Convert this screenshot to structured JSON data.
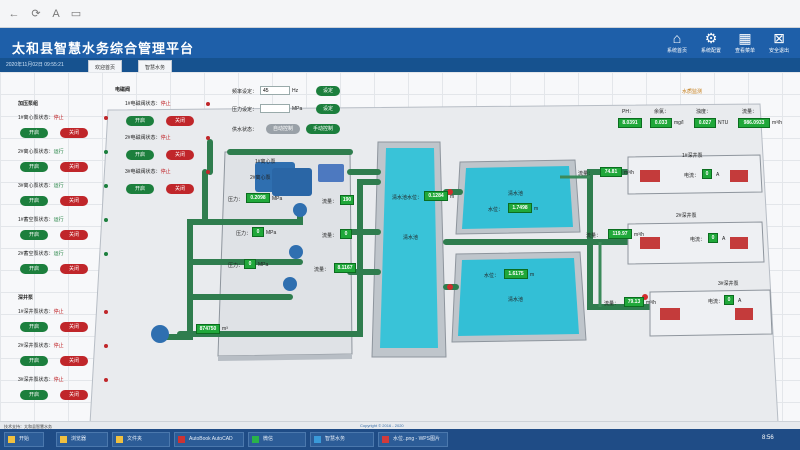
{
  "browser": {
    "back_icon": "←",
    "refresh_icon": "⟳",
    "font_icon": "A",
    "window_icon": "▭"
  },
  "header": {
    "title": "太和县智慧水务综合管理平台",
    "date": "2020年11月02日 09:55:21"
  },
  "topnav": [
    {
      "icon": "home-icon",
      "glyph": "⌂",
      "label": "系统首页"
    },
    {
      "icon": "gear-icon",
      "glyph": "⚙",
      "label": "系统配置"
    },
    {
      "icon": "grid-icon",
      "glyph": "▦",
      "label": "查看菜单"
    },
    {
      "icon": "logout-icon",
      "glyph": "⊠",
      "label": "安全退出"
    }
  ],
  "tabs": [
    {
      "label": "欢迎首页"
    },
    {
      "label": "智慧水务"
    }
  ],
  "left_panel": {
    "pressure_section_title": "加压泵组",
    "pressure_pumps": [
      {
        "label": "1#离心泵状态：",
        "status": "停止",
        "status_class": "stop",
        "start": "开启",
        "stop": "关闭"
      },
      {
        "label": "2#离心泵状态：",
        "status": "运行",
        "status_class": "run",
        "start": "开启",
        "stop": "关闭"
      },
      {
        "label": "3#离心泵状态：",
        "status": "运行",
        "status_class": "run",
        "start": "开启",
        "stop": "关闭"
      },
      {
        "label": "1#蓄空泵状态：",
        "status": "运行",
        "status_class": "run",
        "start": "开启",
        "stop": "关闭"
      },
      {
        "label": "2#蓄空泵状态：",
        "status": "运行",
        "status_class": "run",
        "start": "开启",
        "stop": "关闭"
      }
    ],
    "deep_section_title": "深井泵",
    "deep_pumps": [
      {
        "label": "1#深井泵状态：",
        "status": "停止",
        "status_class": "stop",
        "start": "开启",
        "stop": "关闭"
      },
      {
        "label": "2#深井泵状态：",
        "status": "停止",
        "status_class": "stop",
        "start": "开启",
        "stop": "关闭"
      },
      {
        "label": "3#深井泵状态：",
        "status": "停止",
        "status_class": "stop",
        "start": "开启",
        "stop": "关闭"
      }
    ],
    "valve_section_title": "电磁阀",
    "valves": [
      {
        "label": "1#电磁阀状态：",
        "status": "停止",
        "status_class": "stop",
        "start": "开启",
        "stop": "关闭"
      },
      {
        "label": "2#电磁阀状态：",
        "status": "停止",
        "status_class": "stop",
        "start": "开启",
        "stop": "关闭"
      },
      {
        "label": "3#电磁阀状态：",
        "status": "停止",
        "status_class": "stop",
        "start": "开启",
        "stop": "关闭"
      }
    ]
  },
  "controls": {
    "freq_label": "频率设定：",
    "freq_value": "45",
    "freq_unit": "Hz",
    "freq_btn": "设定",
    "pressure_label": "压力设定：",
    "pressure_unit": "MPa",
    "pressure_btn": "设定",
    "mode_label": "供水状态：",
    "mode_manual": "自动控制",
    "mode_auto": "手动控制"
  },
  "scada": {
    "tank_label": "清水池",
    "tank_level_label": "清水池水位：",
    "tank_level": "0.1284",
    "tank_level_unit": "m",
    "pool1_label": "清水池",
    "pool1_level_label": "水位：",
    "pool1_level": "1.7498",
    "pool1_unit": "m",
    "pool2_label": "清水池",
    "pool2_level_label": "水位：",
    "pool2_level": "1.6175",
    "pool2_unit": "m",
    "pump_room_label": "1#离心泵",
    "pump2_label": "2#离心泵",
    "pressure_readings": [
      {
        "label": "压力：",
        "value": "0.2098",
        "unit": "MPa"
      },
      {
        "label": "压力：",
        "value": "0",
        "unit": "MPa"
      },
      {
        "label": "压力：",
        "value": "0",
        "unit": "MPa"
      }
    ],
    "flow_readings": [
      {
        "label": "流量：",
        "value": "190"
      },
      {
        "label": "流量：",
        "value": "0"
      },
      {
        "label": "流量：",
        "value": "8.1167"
      }
    ],
    "total_flow": "874750",
    "total_unit": "m³",
    "well_labels": [
      "1#深井泵",
      "2#深井泵",
      "3#深井泵"
    ],
    "well_flow_label": "流量：",
    "well_flows": [
      "74.81",
      "119.97",
      "79.13"
    ],
    "well_flow_unit": "m³/h",
    "well_current_label": "电流：",
    "well_currents": [
      "0",
      "0",
      "0"
    ],
    "well_current_unit": "A"
  },
  "quality": {
    "title": "水质监测",
    "ph_label": "PH：",
    "ph_value": "8.0391",
    "chlorine_label": "余氯：",
    "chlorine_value": "0.033",
    "chlorine_unit": "mg/l",
    "turbidity_label": "浊度：",
    "turbidity_value": "0.027",
    "turbidity_unit": "NTU",
    "flow_label": "流量：",
    "flow_value": "986.0933",
    "flow_unit": "m³/h"
  },
  "statusline": {
    "left": "技术支持：太和县智慧水务",
    "copyright": "Copyright © 2016 - 2020"
  },
  "taskbar": {
    "items": [
      "开始",
      "浏览器",
      "文件夹",
      "AutoBook AutoCAD",
      "微信",
      "智慧水务",
      "水位..png - WPS图片"
    ],
    "clock": "8:56"
  }
}
